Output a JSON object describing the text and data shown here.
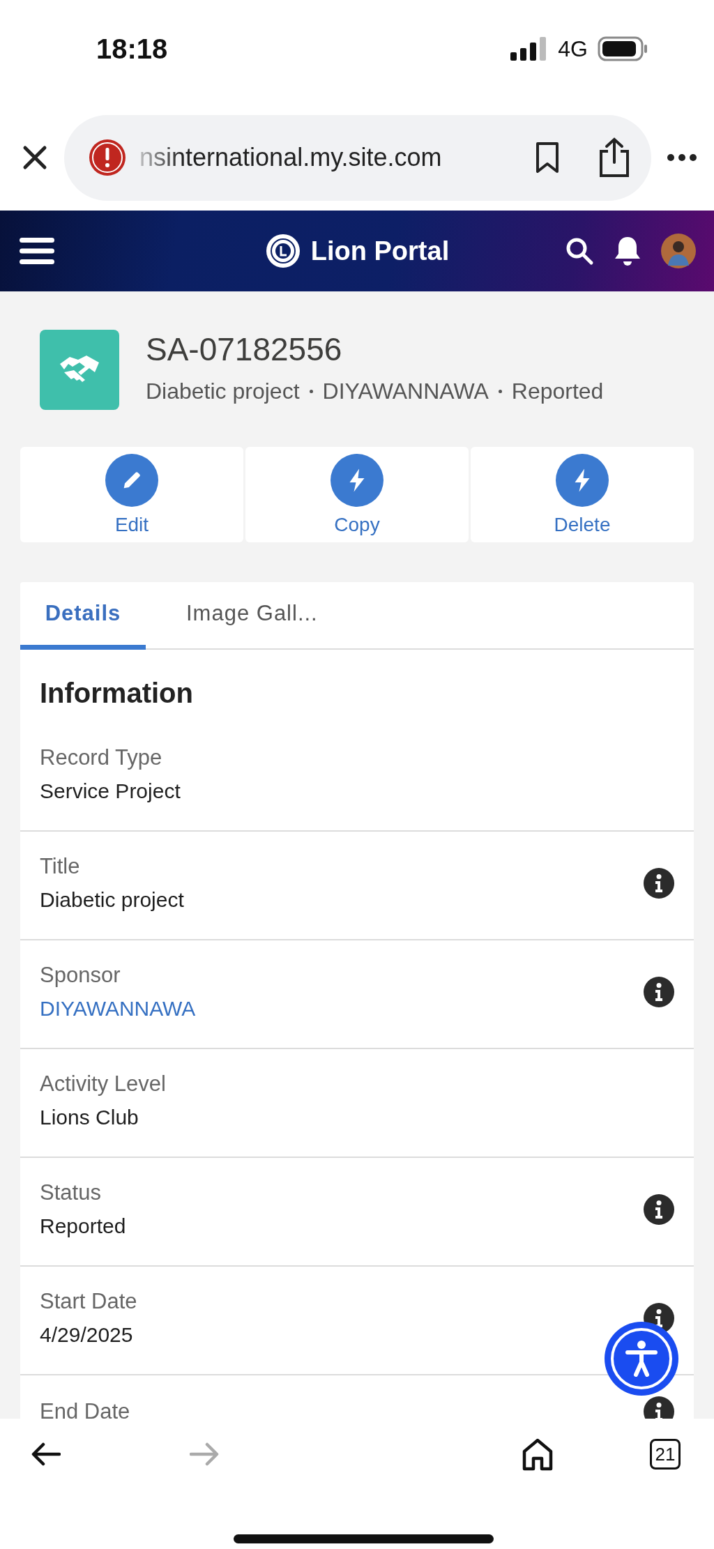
{
  "status_bar": {
    "time": "18:18",
    "network": "4G"
  },
  "browser": {
    "url": "nsinternational.my.site.com",
    "tab_count": "21"
  },
  "header": {
    "title": "Lion Portal"
  },
  "record": {
    "id": "SA-07182556",
    "subtitle": [
      "Diabetic project",
      "DIYAWANNAWA",
      "Reported"
    ]
  },
  "actions": [
    {
      "label": "Edit",
      "kind": "edit"
    },
    {
      "label": "Copy",
      "kind": "bolt"
    },
    {
      "label": "Delete",
      "kind": "bolt"
    }
  ],
  "tabs": [
    {
      "label": "Details",
      "selected": true
    },
    {
      "label": "Image Gall...",
      "selected": false
    }
  ],
  "section": {
    "title": "Information"
  },
  "fields": [
    {
      "label": "Record Type",
      "value": "Service Project",
      "link": false,
      "info": false
    },
    {
      "label": "Title",
      "value": "Diabetic project",
      "link": false,
      "info": true
    },
    {
      "label": "Sponsor",
      "value": "DIYAWANNAWA",
      "link": true,
      "info": true
    },
    {
      "label": "Activity Level",
      "value": "Lions Club",
      "link": false,
      "info": false
    },
    {
      "label": "Status",
      "value": "Reported",
      "link": false,
      "info": true
    },
    {
      "label": "Start Date",
      "value": "4/29/2025",
      "link": false,
      "info": true
    },
    {
      "label": "End Date",
      "info": true
    }
  ]
}
